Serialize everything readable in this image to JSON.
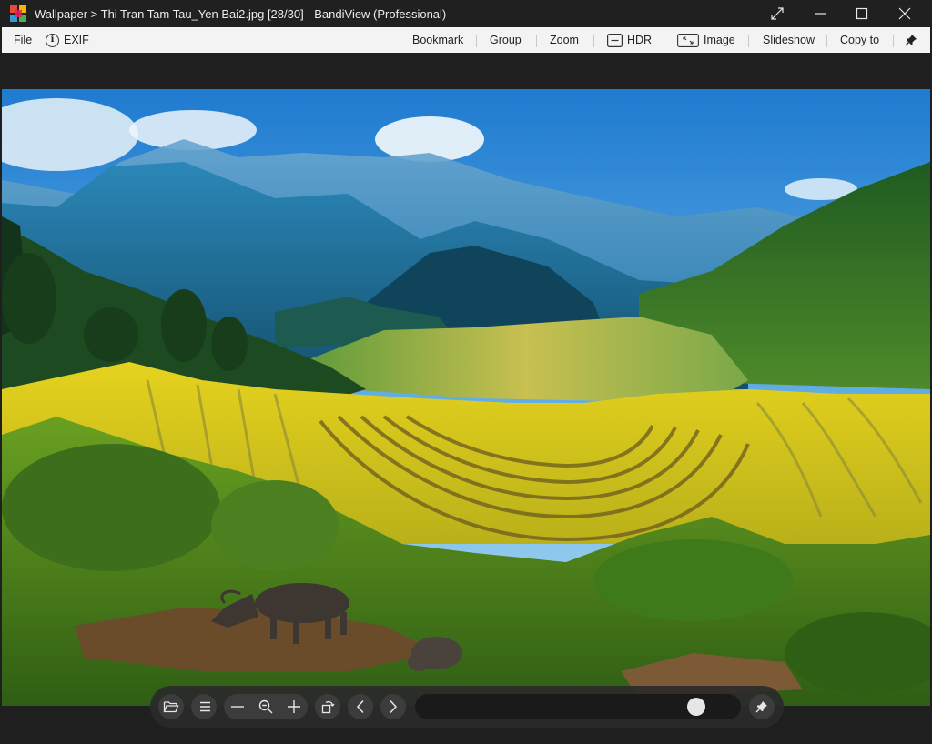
{
  "window": {
    "title": "Wallpaper > Thi Tran Tam Tau_Yen Bai2.jpg [28/30] - BandiView (Professional)",
    "icons": [
      "app-logo-icon",
      "restore-fullscreen-icon",
      "minimize-icon",
      "maximize-icon",
      "close-icon"
    ]
  },
  "menu": {
    "file": "File",
    "exif": "EXIF",
    "bookmark": "Bookmark",
    "group": "Group",
    "zoom": "Zoom",
    "hdr": "HDR",
    "image": "Image",
    "slideshow": "Slideshow",
    "copy_to": "Copy to"
  },
  "viewer": {
    "image_subject": "Rice terraces with water buffalo, Tram Tau, Yen Bai",
    "colors": {
      "sky": "#3a8fd6",
      "mountain": "#1f6e98",
      "terrace": "#d9c21c",
      "grass": "#4c8f1e"
    }
  },
  "toolbar": {
    "buttons": [
      "open-folder-icon",
      "list-icon",
      "zoom-out-minus-icon",
      "zoom-fit-icon",
      "zoom-in-plus-icon",
      "rotate-icon",
      "previous-icon",
      "next-icon",
      "pin-icon"
    ],
    "position_fraction": 0.895
  },
  "theme": {
    "titlebar_bg": "#202020",
    "menubar_bg": "#f3f3f3",
    "toolbar_bg": "#2a2a2a"
  }
}
